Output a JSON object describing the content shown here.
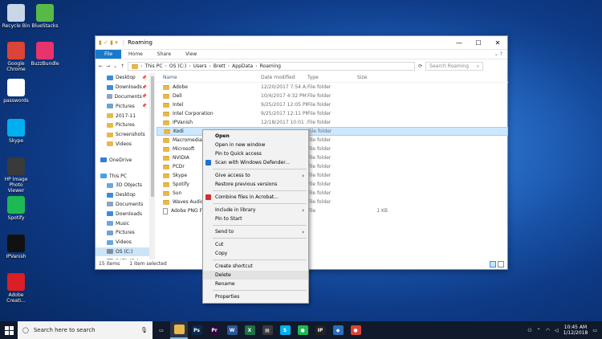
{
  "desktop": {
    "icons": [
      {
        "label": "Recycle Bin",
        "color": "#c9d6e6"
      },
      {
        "label": "BlueStacks",
        "color": "#58b947"
      },
      {
        "label": "Google Chrome",
        "color": "#db4437"
      },
      {
        "label": "BuzzBundle",
        "color": "#e8336d"
      },
      {
        "label": "passwords",
        "color": "#ffffff"
      },
      {
        "label": "Skype",
        "color": "#00aff0"
      },
      {
        "label": "HP Image Photo Viewer",
        "color": "#3a3a3a"
      },
      {
        "label": "Spotify",
        "color": "#1db954"
      },
      {
        "label": "IPVanish",
        "color": "#111111"
      },
      {
        "label": "Adobe Creati...",
        "color": "#da1f26"
      }
    ]
  },
  "explorer": {
    "title": "Roaming",
    "ribbon": {
      "file": "File",
      "home": "Home",
      "share": "Share",
      "view": "View"
    },
    "address": {
      "crumbs": [
        "This PC",
        "OS (C:)",
        "Users",
        "Brett",
        "AppData",
        "Roaming"
      ],
      "search_placeholder": "Search Roaming"
    },
    "nav": [
      {
        "label": "Desktop",
        "pinned": true,
        "color": "#3d8ad8"
      },
      {
        "label": "Downloads",
        "pinned": true,
        "color": "#3d8ad8"
      },
      {
        "label": "Documents",
        "pinned": true,
        "color": "#8fa4bd"
      },
      {
        "label": "Pictures",
        "pinned": true,
        "color": "#6fa1d1"
      },
      {
        "label": "2017-11",
        "pinned": false,
        "color": "#e8b94a"
      },
      {
        "label": "Pictures",
        "pinned": false,
        "color": "#e8b94a"
      },
      {
        "label": "Screenshots",
        "pinned": false,
        "color": "#e8b94a"
      },
      {
        "label": "Videos",
        "pinned": false,
        "color": "#e8b94a"
      },
      {
        "label": "",
        "pinned": false,
        "color": ""
      },
      {
        "label": "OneDrive",
        "pinned": false,
        "color": "#2f7fd8"
      },
      {
        "label": "",
        "pinned": false,
        "color": ""
      },
      {
        "label": "This PC",
        "pinned": false,
        "color": "#4aa0e6"
      },
      {
        "label": "3D Objects",
        "pinned": false,
        "color": "#6aa7de"
      },
      {
        "label": "Desktop",
        "pinned": false,
        "color": "#3d8ad8"
      },
      {
        "label": "Documents",
        "pinned": false,
        "color": "#8fa4bd"
      },
      {
        "label": "Downloads",
        "pinned": false,
        "color": "#3d8ad8"
      },
      {
        "label": "Music",
        "pinned": false,
        "color": "#6aa7de"
      },
      {
        "label": "Pictures",
        "pinned": false,
        "color": "#6fa1d1"
      },
      {
        "label": "Videos",
        "pinned": false,
        "color": "#6aa7de"
      },
      {
        "label": "OS (C:)",
        "pinned": false,
        "color": "#7f8fa3",
        "selected": true
      },
      {
        "label": "DATA (D:)",
        "pinned": false,
        "color": "#7f8fa3"
      }
    ],
    "columns": {
      "name": "Name",
      "date": "Date modified",
      "type": "Type",
      "size": "Size"
    },
    "files": [
      {
        "name": "Adobe",
        "date": "12/20/2017 7:54 A...",
        "type": "File folder",
        "size": ""
      },
      {
        "name": "Dell",
        "date": "10/4/2017 4:32 PM",
        "type": "File folder",
        "size": ""
      },
      {
        "name": "Intel",
        "date": "9/25/2017 12:05 PM",
        "type": "File folder",
        "size": ""
      },
      {
        "name": "Intel Corporation",
        "date": "9/25/2017 12:11 PM",
        "type": "File folder",
        "size": ""
      },
      {
        "name": "IPVanish",
        "date": "12/18/2017 10:01 ...",
        "type": "File folder",
        "size": ""
      },
      {
        "name": "Kodi",
        "date": "",
        "type": "File folder",
        "size": "",
        "selected": true
      },
      {
        "name": "Macromedia",
        "date": "",
        "type": "File folder",
        "size": ""
      },
      {
        "name": "Microsoft",
        "date": "",
        "type": "File folder",
        "size": ""
      },
      {
        "name": "NVIDIA",
        "date": "",
        "type": "File folder",
        "size": ""
      },
      {
        "name": "PCDr",
        "date": "",
        "type": "File folder",
        "size": ""
      },
      {
        "name": "Skype",
        "date": "",
        "type": "File folder",
        "size": ""
      },
      {
        "name": "Spotify",
        "date": "",
        "type": "File folder",
        "size": ""
      },
      {
        "name": "Sun",
        "date": "",
        "type": "File folder",
        "size": ""
      },
      {
        "name": "Waves Audio",
        "date": "",
        "type": "File folder",
        "size": ""
      },
      {
        "name": "Adobe PNG Fo...",
        "date": "",
        "type": "File",
        "size": "1 KB",
        "file": true
      }
    ],
    "status": {
      "count": "15 items",
      "selected": "1 item selected"
    }
  },
  "context_menu": {
    "items": [
      {
        "label": "Open",
        "bold": true
      },
      {
        "label": "Open in new window"
      },
      {
        "label": "Pin to Quick access"
      },
      {
        "label": "Scan with Windows Defender...",
        "icon": "#1f6fd1"
      },
      {
        "sep": true
      },
      {
        "label": "Give access to",
        "arrow": true
      },
      {
        "label": "Restore previous versions"
      },
      {
        "sep": true
      },
      {
        "label": "Combine files in Acrobat...",
        "icon": "#d32f2f"
      },
      {
        "sep": true
      },
      {
        "label": "Include in library",
        "arrow": true
      },
      {
        "label": "Pin to Start"
      },
      {
        "sep": true
      },
      {
        "label": "Send to",
        "arrow": true
      },
      {
        "sep": true
      },
      {
        "label": "Cut"
      },
      {
        "label": "Copy"
      },
      {
        "sep": true
      },
      {
        "label": "Create shortcut"
      },
      {
        "label": "Delete",
        "highlight": true
      },
      {
        "label": "Rename"
      },
      {
        "sep": true
      },
      {
        "label": "Properties"
      }
    ]
  },
  "taskbar": {
    "search_placeholder": "Search here to search",
    "apps": [
      {
        "name": "task-view",
        "glyph": "▭",
        "color": "#101a2b"
      },
      {
        "name": "file-explorer",
        "glyph": "",
        "color": "#e8b94a",
        "active": true
      },
      {
        "name": "photoshop",
        "glyph": "Ps",
        "color": "#0b2a4a"
      },
      {
        "name": "premiere",
        "glyph": "Pr",
        "color": "#2a0a3a"
      },
      {
        "name": "word",
        "glyph": "W",
        "color": "#2b5797"
      },
      {
        "name": "excel",
        "glyph": "X",
        "color": "#1e7145"
      },
      {
        "name": "store",
        "glyph": "▤",
        "color": "#3a3a3a"
      },
      {
        "name": "skype",
        "glyph": "S",
        "color": "#00aff0"
      },
      {
        "name": "spotify",
        "glyph": "●",
        "color": "#1db954"
      },
      {
        "name": "ipvanish",
        "glyph": "IP",
        "color": "#222222"
      },
      {
        "name": "maps",
        "glyph": "◆",
        "color": "#2a6ebd"
      },
      {
        "name": "chrome",
        "glyph": "●",
        "color": "#db4437"
      }
    ],
    "time": "10:45 AM",
    "date": "1/12/2018"
  }
}
